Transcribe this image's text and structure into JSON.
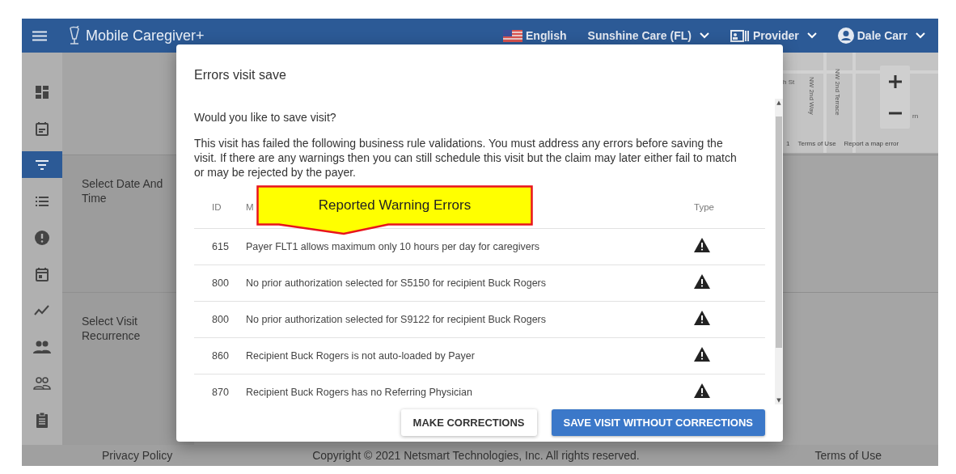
{
  "header": {
    "app_name": "Mobile Caregiver+",
    "language": "English",
    "agency": "Sunshine Care (FL)",
    "role": "Provider",
    "user": "Dale Carr"
  },
  "sidebar": {
    "items": [
      {
        "kind": "dashboard",
        "selected": false
      },
      {
        "kind": "calendar-note",
        "selected": false
      },
      {
        "kind": "filter",
        "selected": true
      },
      {
        "kind": "list",
        "selected": false
      },
      {
        "kind": "alert",
        "selected": false
      },
      {
        "kind": "calendar-day",
        "selected": false
      },
      {
        "kind": "trend",
        "selected": false
      },
      {
        "kind": "people",
        "selected": false
      },
      {
        "kind": "people-outline",
        "selected": false
      },
      {
        "kind": "clipboard",
        "selected": false
      }
    ]
  },
  "map": {
    "labels": [
      "h St",
      "NW 2nd Way",
      "NW 2nd Terrace",
      "rn"
    ],
    "attribution": [
      "1",
      "Terms of Use",
      "Report a map error"
    ]
  },
  "sections": [
    {
      "label": "Select Date And Time"
    },
    {
      "label": "Select Visit Recurrence"
    }
  ],
  "dialog": {
    "title": "Errors visit save",
    "question": "Would you like to save visit?",
    "message": "This visit has failed the following business rule validations. You must address any errors before saving the visit. If there are any warnings then you can still schedule this visit but the claim may later either fail to match or may be rejected by the payer.",
    "columns": [
      "ID",
      "M",
      "Type"
    ],
    "rows": [
      {
        "id": "615",
        "message": "Payer FLT1 allows maximum only 10 hours per day for caregivers",
        "kind": "warning"
      },
      {
        "id": "800",
        "message": "No prior authorization selected for S5150 for recipient Buck Rogers",
        "kind": "warning"
      },
      {
        "id": "800",
        "message": "No prior authorization selected for S9122 for recipient Buck Rogers",
        "kind": "warning"
      },
      {
        "id": "860",
        "message": "Recipient Buck Rogers is not auto-loaded by Payer",
        "kind": "warning"
      },
      {
        "id": "870",
        "message": "Recipient Buck Rogers has no Referring Physician",
        "kind": "warning"
      }
    ],
    "buttons": [
      {
        "label": "MAKE CORRECTIONS",
        "kind": "secondary"
      },
      {
        "label": "SAVE VISIT WITHOUT CORRECTIONS",
        "kind": "primary"
      }
    ]
  },
  "scrollbar": {
    "up": "▲",
    "down": "▼"
  },
  "callout": {
    "text": "Reported Warning Errors"
  },
  "footer": {
    "privacy": "Privacy Policy",
    "copyright": "Copyright © 2021 Netsmart Technologies, Inc. All rights reserved.",
    "terms": "Terms of Use"
  }
}
